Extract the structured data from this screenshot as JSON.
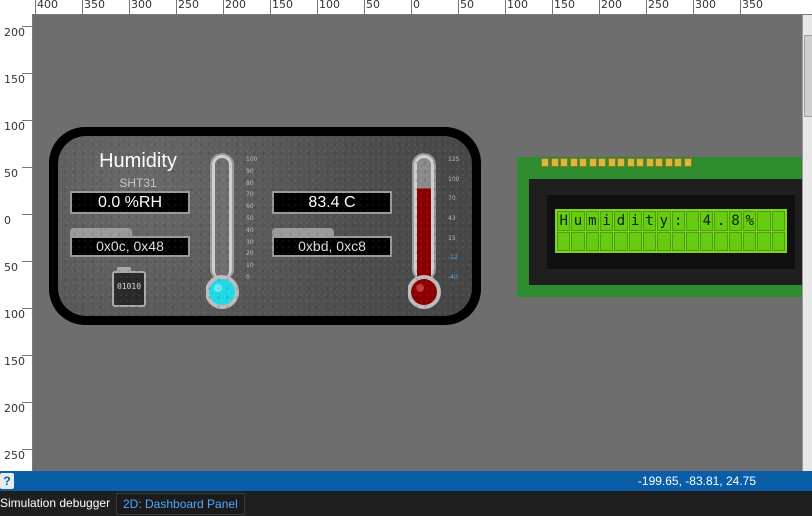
{
  "ruler": {
    "top_ticks": [
      "400",
      "350",
      "300",
      "250",
      "200",
      "150",
      "100",
      "50",
      "0",
      "50",
      "100",
      "150",
      "200",
      "250",
      "300",
      "350"
    ],
    "left_ticks": [
      "200",
      "150",
      "100",
      "50",
      "0",
      "50",
      "100",
      "150",
      "200",
      "250"
    ]
  },
  "panel": {
    "title": "Humidity",
    "subtitle": "SHT31",
    "humidity_readout": "0.0 %RH",
    "temperature_readout": "83.4 C",
    "left_address": "0x0c, 0x48",
    "right_address": "0xbd, 0xc8",
    "chip_label": "01010",
    "humidity_scale": [
      "100",
      "90",
      "80",
      "70",
      "60",
      "50",
      "40",
      "30",
      "20",
      "10",
      "0"
    ],
    "temperature_scale": [
      "125",
      "100",
      "70",
      "43",
      "15",
      "-12",
      "-40"
    ],
    "humidity_level": 0.0,
    "temperature_level_fraction": 0.746,
    "colors": {
      "humidity_fluid": "#1fd8e8",
      "temperature_fluid": "#8b0000"
    }
  },
  "lcd": {
    "row1": "Humidity: 4.8%",
    "row2": "",
    "pin_count": 16
  },
  "status": {
    "help_icon": "?",
    "coordinates": "-199.65, -83.81, 24.75"
  },
  "bottom": {
    "label": "Simulation debugger",
    "active_tab": "2D: Dashboard Panel"
  }
}
